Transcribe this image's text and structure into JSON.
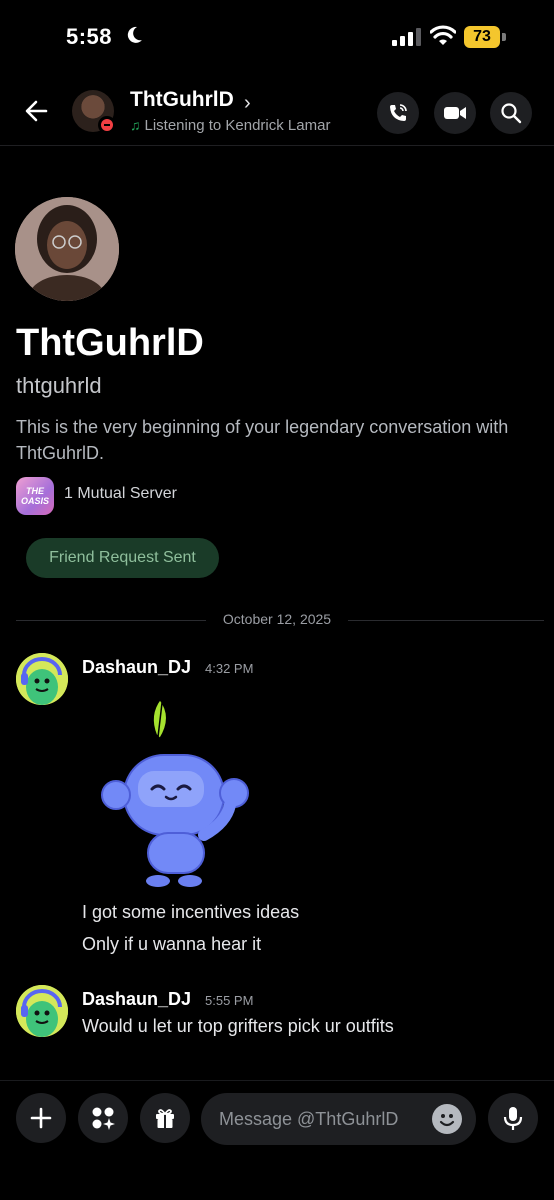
{
  "status_bar": {
    "time": "5:58",
    "battery": "73"
  },
  "header": {
    "name": "ThtGuhrlD",
    "chevron": "›",
    "activity": "Listening to Kendrick Lamar",
    "icons": [
      "back-arrow-icon",
      "phone-call-icon",
      "video-camera-icon",
      "search-icon"
    ]
  },
  "profile": {
    "display_name": "ThtGuhrlD",
    "username": "thtguhrld",
    "intro": "This is the very beginning of your legendary conversation with ThtGuhrlD.",
    "server_icon_text": "THE OASIS",
    "mutual_servers": "1 Mutual Server",
    "friend_button": "Friend Request Sent"
  },
  "divider": {
    "date": "October 12, 2025"
  },
  "messages": [
    {
      "author": "Dashaun_DJ",
      "time": "4:32 PM",
      "lines": [
        "I got some incentives ideas",
        "Only if u wanna hear it"
      ]
    },
    {
      "author": "Dashaun_DJ",
      "time": "5:55 PM",
      "lines": [
        "Would u let ur top grifters pick ur outfits"
      ]
    }
  ],
  "composer": {
    "placeholder": "Message @ThtGuhrlD",
    "icons": [
      "plus-icon",
      "apps-icon",
      "gift-icon",
      "emoji-icon",
      "microphone-icon"
    ]
  },
  "colors": {
    "accent_green": "#23a55a",
    "dnd_red": "#f23f43",
    "battery_yellow": "#f4c62d"
  }
}
